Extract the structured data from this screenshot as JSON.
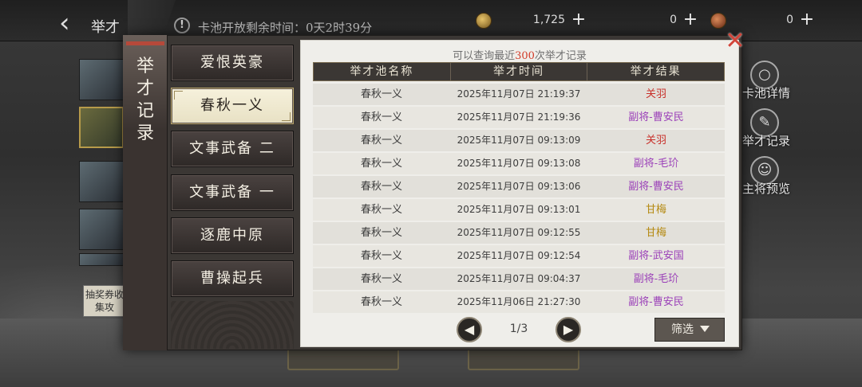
{
  "topbar": {
    "back_title": "举才",
    "notice_icon": "!",
    "notice_text": "卡池开放剩余时间：0天2时39分",
    "currencies": [
      {
        "amount": "1,725",
        "icon": "coin-icon"
      },
      {
        "amount": "0",
        "icon": "token-icon"
      },
      {
        "amount": "0",
        "icon": "red-token-icon"
      }
    ]
  },
  "side_banner": "抽奖券收集攻",
  "side_actions": [
    {
      "label": "卡池详情",
      "icon": "magnifier-icon",
      "glyph": "○"
    },
    {
      "label": "举才记录",
      "icon": "brush-icon",
      "glyph": "✎"
    },
    {
      "label": "主将预览",
      "icon": "general-icon",
      "glyph": "☺"
    }
  ],
  "modal": {
    "title": "举才记录",
    "categories": [
      {
        "label": "爱恨英豪",
        "active": false
      },
      {
        "label": "春秋一义",
        "active": true
      },
      {
        "label": "文事武备 二",
        "active": false
      },
      {
        "label": "文事武备 一",
        "active": false
      },
      {
        "label": "逐鹿中原",
        "active": false
      },
      {
        "label": "曹操起兵",
        "active": false
      }
    ],
    "subtitle_pre": "可以查询最近",
    "subtitle_num": "300",
    "subtitle_post": "次举才记录",
    "columns": [
      "举才池名称",
      "举才时间",
      "举才结果"
    ],
    "records": [
      {
        "pool": "春秋一义",
        "time": "2025年11月07日 21:19:37",
        "result": "关羽",
        "color": "#c8302a"
      },
      {
        "pool": "春秋一义",
        "time": "2025年11月07日 21:19:36",
        "result": "副将-曹安民",
        "color": "#9a3fb8"
      },
      {
        "pool": "春秋一义",
        "time": "2025年11月07日 09:13:09",
        "result": "关羽",
        "color": "#c8302a"
      },
      {
        "pool": "春秋一义",
        "time": "2025年11月07日 09:13:08",
        "result": "副将-毛玠",
        "color": "#9a3fb8"
      },
      {
        "pool": "春秋一义",
        "time": "2025年11月07日 09:13:06",
        "result": "副将-曹安民",
        "color": "#9a3fb8"
      },
      {
        "pool": "春秋一义",
        "time": "2025年11月07日 09:13:01",
        "result": "甘梅",
        "color": "#b58a12"
      },
      {
        "pool": "春秋一义",
        "time": "2025年11月07日 09:12:55",
        "result": "甘梅",
        "color": "#b58a12"
      },
      {
        "pool": "春秋一义",
        "time": "2025年11月07日 09:12:54",
        "result": "副将-武安国",
        "color": "#9a3fb8"
      },
      {
        "pool": "春秋一义",
        "time": "2025年11月07日 09:04:37",
        "result": "副将-毛玠",
        "color": "#9a3fb8"
      },
      {
        "pool": "春秋一义",
        "time": "2025年11月06日 21:27:30",
        "result": "副将-曹安民",
        "color": "#9a3fb8"
      }
    ],
    "page": "1/3",
    "prev_glyph": "◀",
    "next_glyph": "▶",
    "filter_label": "筛选",
    "close_glyph": "✕"
  }
}
